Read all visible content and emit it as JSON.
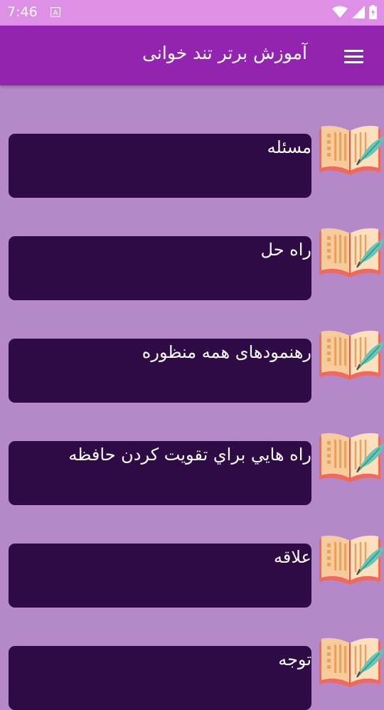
{
  "status_bar": {
    "time": "7:46",
    "icons": [
      "accessibility-notification-icon",
      "wifi-icon",
      "signal-icon",
      "battery-icon"
    ]
  },
  "app_bar": {
    "title": "آموزش برتر تند خوانی",
    "menu_icon": "hamburger-menu-icon"
  },
  "items": [
    {
      "label": "مسئله"
    },
    {
      "label": "راه حل"
    },
    {
      "label": "رهنمودهای همه منظوره"
    },
    {
      "label": "راه هايي براي تقويت كردن حافظه"
    },
    {
      "label": "علاقه"
    },
    {
      "label": "توجه"
    }
  ],
  "colors": {
    "status_bar": "#de8fe6",
    "app_bar": "#9324b0",
    "background": "#b589c9",
    "card": "#2e0b44",
    "text": "#ffffff"
  }
}
